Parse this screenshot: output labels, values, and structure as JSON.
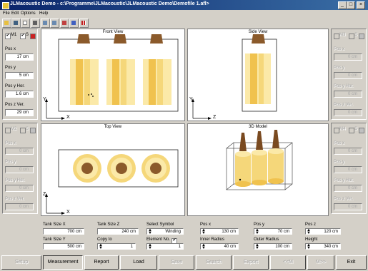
{
  "window": {
    "title": "JLMacoustic Demo  -  c:\\Programme\\JLMacoustic\\JLMacoustic Demo\\Demofile 1.afl>"
  },
  "menu": [
    "File",
    "Edit",
    "Options",
    "Help"
  ],
  "toolbar_icons": [
    "open-file-icon",
    "save-icon",
    "new-icon",
    "print-icon",
    "import-icon",
    "export-icon",
    "undo-icon",
    "redo-icon",
    "grid-icon"
  ],
  "left_panel_top": {
    "m1_label": "M1",
    "m1_checked": "✔",
    "s_label": "S",
    "s_checked": "✔",
    "fields": [
      {
        "label": "Pos x",
        "value": "17  cm"
      },
      {
        "label": "Pos y",
        "value": "5  cm"
      },
      {
        "label": "Pos y Hor.",
        "value": "1.6  cm"
      },
      {
        "label": "Pos z Ver.",
        "value": "29  cm"
      }
    ]
  },
  "left_panel_bottom": {
    "m_label": "M2",
    "s_label": "S",
    "fields": [
      {
        "label": "Pos x",
        "value": "0  cm"
      },
      {
        "label": "Pos y",
        "value": "0  cm"
      },
      {
        "label": "Pos y Hor.",
        "value": "0  cm"
      },
      {
        "label": "Pos z Ver.",
        "value": "0  cm"
      }
    ]
  },
  "right_panel_top": {
    "m_label": "M3",
    "s_label": "S",
    "fields": [
      {
        "label": "Pos x",
        "value": "0  cm"
      },
      {
        "label": "Pos y",
        "value": "0  cm"
      },
      {
        "label": "Pos y Hor.",
        "value": "0  cm"
      },
      {
        "label": "Pos z Ver.",
        "value": "0  cm"
      }
    ]
  },
  "right_panel_bottom": {
    "m_label": "M4",
    "s_label": "S",
    "fields": [
      {
        "label": "Pos x",
        "value": "0  cm"
      },
      {
        "label": "Pos y",
        "value": "0  cm"
      },
      {
        "label": "Pos y Hor.",
        "value": "0  cm"
      },
      {
        "label": "Pos z Ver.",
        "value": "0  cm"
      }
    ]
  },
  "views": {
    "front": {
      "title": "Front View",
      "axis_v": "Y",
      "axis_h": "X"
    },
    "side": {
      "title": "Side View",
      "axis_v": "Y",
      "axis_h": "Z"
    },
    "top": {
      "title": "Top View",
      "axis_v": "Z",
      "axis_h": "X"
    },
    "model": {
      "title": "3D Model"
    }
  },
  "params": {
    "tank_x": {
      "label": "Tank Size X",
      "value": "700  cm"
    },
    "tank_z": {
      "label": "Tank Size Z",
      "value": "240  cm"
    },
    "select_symbol": {
      "label": "Select Symbol",
      "value": "Winding"
    },
    "pos_x": {
      "label": "Pos x",
      "value": "130  cm"
    },
    "pos_y": {
      "label": "Pos y",
      "value": "70  cm"
    },
    "pos_z": {
      "label": "Pos z",
      "value": "120  cm"
    },
    "tank_y": {
      "label": "Tank Size Y",
      "value": "500  cm"
    },
    "copy_to": {
      "label": "Copy to",
      "value": "1"
    },
    "element_no": {
      "label": "Element No.",
      "value": "1",
      "checked": "✔"
    },
    "inner_radius": {
      "label": "Inner Radius",
      "value": "40  cm"
    },
    "outer_radius": {
      "label": "Outer Radius",
      "value": "100  cm"
    },
    "height": {
      "label": "Height",
      "value": "340  cm"
    }
  },
  "buttons": {
    "setup": "Setup",
    "measurement": "Measurement",
    "report": "Report",
    "load": "Load",
    "save": "Save",
    "search": "Search",
    "export": "Export",
    "prev": "<<M",
    "next": "M>>",
    "exit": "Exit"
  },
  "colors": {
    "winding_light": "#fbe9a8",
    "winding_mid": "#f5d77a",
    "winding_dark": "#f0c24e",
    "bushing": "#8b5a2b",
    "core": "#7a4a20",
    "title_blue": "#0a246a",
    "marker_red": "#cc2222"
  }
}
